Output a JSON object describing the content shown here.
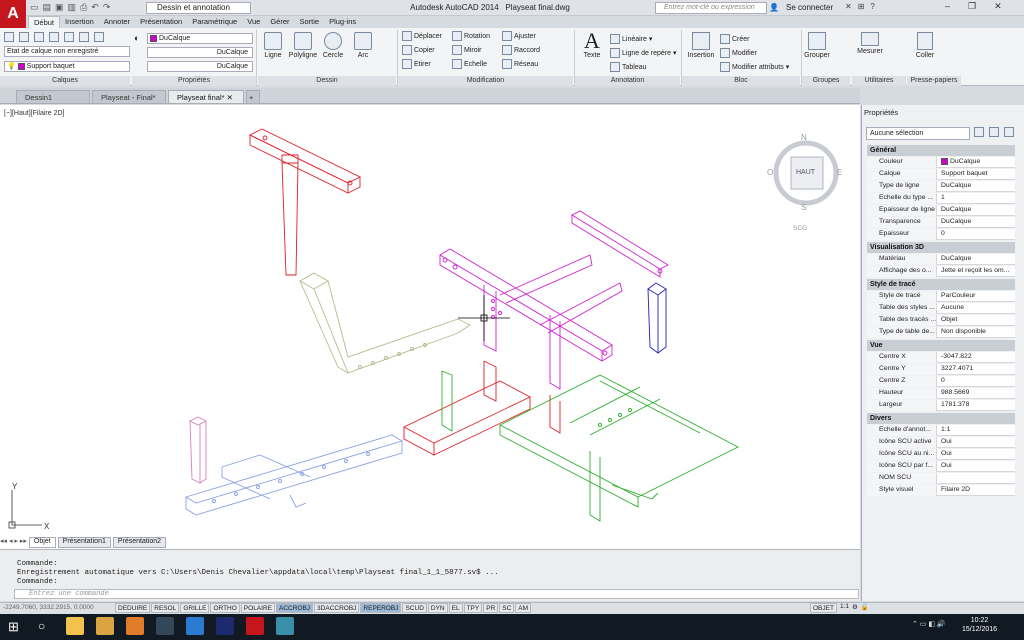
{
  "app": {
    "title": "Autodesk AutoCAD 2014",
    "file": "Playseat final.dwg",
    "logo": "A"
  },
  "titlebar": {
    "workspace": "Dessin et annotation",
    "search_placeholder": "Entrez mot-clé ou expression",
    "connect": "Se connecter"
  },
  "ribbon_tabs": [
    "Début",
    "Insertion",
    "Annoter",
    "Présentation",
    "Paramétrique",
    "Vue",
    "Gérer",
    "Sortie",
    "Plug-ins"
  ],
  "panels": {
    "calques": "Calques",
    "proprietes": "Propriétés",
    "dessin": "Dessin",
    "modification": "Modification",
    "annotation": "Annotation",
    "bloc": "Bloc",
    "groupes": "Groupes",
    "utilitaires": "Utilitaires",
    "pressepapiers": "Presse-papiers"
  },
  "layers": {
    "state": "Etat de calque non enregistré",
    "current": "Support baquet",
    "prop_color": "DuCalque",
    "prop_line": "DuCalque",
    "prop_weight": "DuCalque"
  },
  "draw_tools": [
    "Ligne",
    "Polyligne",
    "Cercle",
    "Arc"
  ],
  "modify_tools": [
    "Déplacer",
    "Rotation",
    "Ajuster",
    "Copier",
    "Miroir",
    "Raccord",
    "Etirer",
    "Echelle",
    "Réseau"
  ],
  "annotation_tools": {
    "text": "Texte",
    "linear": "Linéaire",
    "leader": "Ligne de repère",
    "table": "Tableau"
  },
  "block_tools": {
    "insert": "Insertion",
    "create": "Créer",
    "modify": "Modifier",
    "attrs": "Modifier attributs"
  },
  "right_tools": {
    "group": "Grouper",
    "measure": "Mesurer",
    "paste": "Coller"
  },
  "doc_tabs": [
    "Dessin1",
    "Playseat - Final*",
    "Playseat final*"
  ],
  "view_label": "[−][Haut][Filaire 2D]",
  "viewcube": {
    "n": "N",
    "s": "S",
    "e": "E",
    "o": "O",
    "face": "HAUT",
    "ucs": "SCG"
  },
  "layout_tabs": [
    "Objet",
    "Présentation1",
    "Présentation2"
  ],
  "command": {
    "lines": "Commande:\nEnregistrement automatique vers C:\\Users\\Denis Chevalier\\appdata\\local\\temp\\Playseat final_1_1_5877.sv$ ...\nCommande:",
    "placeholder": "Entrez une commande"
  },
  "coords": "-2249.7060, 3332.2915, 0.0000",
  "status_buttons": [
    {
      "label": "DEDUIRE",
      "on": false
    },
    {
      "label": "RESOL",
      "on": false
    },
    {
      "label": "GRILLE",
      "on": false
    },
    {
      "label": "ORTHO",
      "on": false
    },
    {
      "label": "POLAIRE",
      "on": false
    },
    {
      "label": "ACCROBJ",
      "on": true
    },
    {
      "label": "3DACCROBJ",
      "on": false
    },
    {
      "label": "REPEROBJ",
      "on": true
    },
    {
      "label": "SCUD",
      "on": false
    },
    {
      "label": "DYN",
      "on": false
    },
    {
      "label": "EL",
      "on": false
    },
    {
      "label": "TPY",
      "on": false
    },
    {
      "label": "PR",
      "on": false
    },
    {
      "label": "SC",
      "on": false
    },
    {
      "label": "AM",
      "on": false
    }
  ],
  "status_right": {
    "model": "OBJET",
    "scale": "1:1"
  },
  "clock": {
    "time": "10:22",
    "date": "15/12/2016"
  },
  "properties": {
    "header": "Propriétés",
    "selection": "Aucune sélection",
    "sections": [
      {
        "title": "Général",
        "rows": [
          [
            "Couleur",
            "DuCalque"
          ],
          [
            "Calque",
            "Support baquet"
          ],
          [
            "Type de ligne",
            "DuCalque"
          ],
          [
            "Echelle du type ...",
            "1"
          ],
          [
            "Epaisseur de ligne",
            "DuCalque"
          ],
          [
            "Transparence",
            "DuCalque"
          ],
          [
            "Epaisseur",
            "0"
          ]
        ]
      },
      {
        "title": "Visualisation 3D",
        "rows": [
          [
            "Matériau",
            "DuCalque"
          ],
          [
            "Affichage des o...",
            "Jette et reçoit les om..."
          ]
        ]
      },
      {
        "title": "Style de tracé",
        "rows": [
          [
            "Style de tracé",
            "ParCouleur"
          ],
          [
            "Table des styles ...",
            "Aucune"
          ],
          [
            "Table des tracés ...",
            "Objet"
          ],
          [
            "Type de table de...",
            "Non disponible"
          ]
        ]
      },
      {
        "title": "Vue",
        "rows": [
          [
            "Centre X",
            "-3047.822"
          ],
          [
            "Centre Y",
            "3227.4071"
          ],
          [
            "Centre Z",
            "0"
          ],
          [
            "Hauteur",
            "988.5669"
          ],
          [
            "Largeur",
            "1781.378"
          ]
        ]
      },
      {
        "title": "Divers",
        "rows": [
          [
            "Echelle d'annot...",
            "1:1"
          ],
          [
            "Icône SCU active",
            "Oui"
          ],
          [
            "Icône SCU au ni...",
            "Oui"
          ],
          [
            "Icône SCU par f...",
            "Oui"
          ],
          [
            "NOM SCU",
            ""
          ],
          [
            "Style visuel",
            "Filaire 2D"
          ]
        ]
      }
    ]
  },
  "colors": {
    "red": "#e0202a",
    "magenta": "#d020d0",
    "green": "#30b030",
    "olive": "#b8b890",
    "blue": "#2020c0",
    "lightblue": "#8aa0e8",
    "pink": "#d880c0"
  }
}
